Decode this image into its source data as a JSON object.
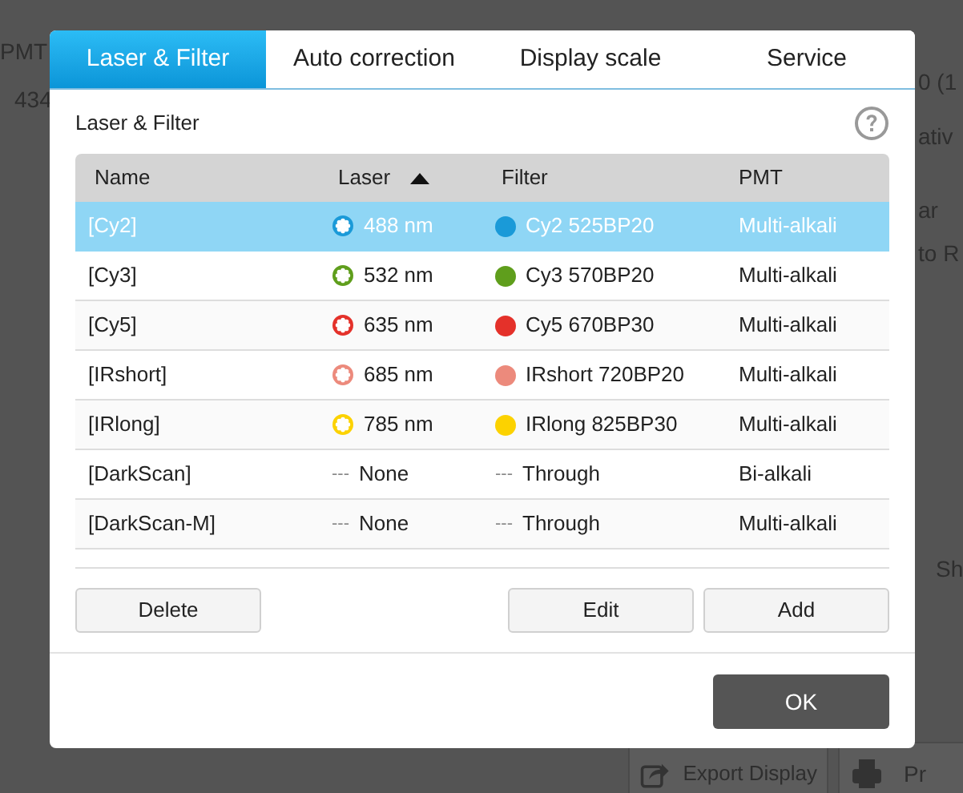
{
  "background": {
    "texts": [
      {
        "kind": "left",
        "text": "PMT"
      },
      {
        "kind": "left2",
        "text": "434"
      },
      {
        "kind": "right1",
        "text": "0 (1"
      },
      {
        "kind": "right2",
        "text": "ativ"
      },
      {
        "kind": "right3",
        "text": "ar"
      },
      {
        "kind": "right4",
        "text": "to R"
      },
      {
        "kind": "right5",
        "text": "Sh"
      }
    ],
    "export_button": "Export Display",
    "print_button": "Pr"
  },
  "tabs": [
    {
      "label": "Laser & Filter",
      "selected": true
    },
    {
      "label": "Auto correction",
      "selected": false
    },
    {
      "label": "Display scale",
      "selected": false
    },
    {
      "label": "Service",
      "selected": false
    }
  ],
  "section_title": "Laser & Filter",
  "table": {
    "columns": [
      {
        "label": "Name",
        "sorted": false
      },
      {
        "label": "Laser",
        "sorted": true
      },
      {
        "label": "Filter",
        "sorted": false
      },
      {
        "label": "PMT",
        "sorted": false
      }
    ],
    "rows": [
      {
        "name": "[Cy2]",
        "laser": {
          "kind": "laser",
          "color": "#1a9ad8",
          "text": "488 nm"
        },
        "filter": {
          "kind": "dot",
          "color": "#1a9ad8",
          "text": "Cy2 525BP20"
        },
        "pmt": "Multi-alkali",
        "selected": true
      },
      {
        "name": "[Cy3]",
        "laser": {
          "kind": "laser",
          "color": "#5f9e1c",
          "text": "532 nm"
        },
        "filter": {
          "kind": "dot",
          "color": "#5f9e1c",
          "text": "Cy3 570BP20"
        },
        "pmt": "Multi-alkali",
        "selected": false
      },
      {
        "name": "[Cy5]",
        "laser": {
          "kind": "laser",
          "color": "#e4312a",
          "text": "635 nm"
        },
        "filter": {
          "kind": "dot",
          "color": "#e4312a",
          "text": "Cy5 670BP30"
        },
        "pmt": "Multi-alkali",
        "selected": false
      },
      {
        "name": "[IRshort]",
        "laser": {
          "kind": "laser",
          "color": "#ec8a7c",
          "text": "685 nm"
        },
        "filter": {
          "kind": "dot",
          "color": "#ec8a7c",
          "text": "IRshort 720BP20"
        },
        "pmt": "Multi-alkali",
        "selected": false
      },
      {
        "name": "[IRlong]",
        "laser": {
          "kind": "laser",
          "color": "#fcd200",
          "text": "785 nm"
        },
        "filter": {
          "kind": "dot",
          "color": "#fcd200",
          "text": "IRlong 825BP30"
        },
        "pmt": "Multi-alkali",
        "selected": false
      },
      {
        "name": "[DarkScan]",
        "laser": {
          "kind": "dash",
          "dash": "---",
          "text": "None"
        },
        "filter": {
          "kind": "dash",
          "dash": "---",
          "text": "Through"
        },
        "pmt": "Bi-alkali",
        "selected": false
      },
      {
        "name": "[DarkScan-M]",
        "laser": {
          "kind": "dash",
          "dash": "---",
          "text": "None"
        },
        "filter": {
          "kind": "dash",
          "dash": "---",
          "text": "Through"
        },
        "pmt": "Multi-alkali",
        "selected": false
      }
    ]
  },
  "buttons": {
    "delete": "Delete",
    "edit": "Edit",
    "add": "Add",
    "ok": "OK"
  }
}
